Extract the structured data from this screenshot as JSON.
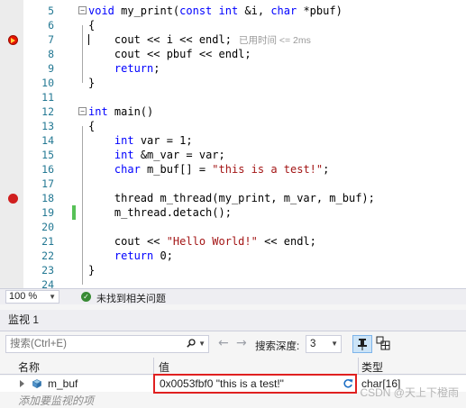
{
  "editor": {
    "lines": [
      {
        "num": "5",
        "glyph": "",
        "fold": "minus",
        "change": false,
        "segs": [
          [
            "k",
            "void"
          ],
          [
            "t",
            " my_print("
          ],
          [
            "k",
            "const"
          ],
          [
            "t",
            " "
          ],
          [
            "k",
            "int"
          ],
          [
            "t",
            " &i, "
          ],
          [
            "k",
            "char"
          ],
          [
            "t",
            " *pbuf)"
          ]
        ]
      },
      {
        "num": "6",
        "glyph": "",
        "fold": "",
        "change": false,
        "segs": [
          [
            "t",
            "{"
          ]
        ]
      },
      {
        "num": "7",
        "glyph": "current",
        "fold": "",
        "change": false,
        "hint": "已用时间 <= 2ms",
        "segs": [
          [
            "t",
            "    cout << i << endl;"
          ]
        ]
      },
      {
        "num": "8",
        "glyph": "",
        "fold": "",
        "change": false,
        "segs": [
          [
            "t",
            "    cout << pbuf << endl;"
          ]
        ]
      },
      {
        "num": "9",
        "glyph": "",
        "fold": "",
        "change": false,
        "segs": [
          [
            "t",
            "    "
          ],
          [
            "k",
            "return"
          ],
          [
            "t",
            ";"
          ]
        ]
      },
      {
        "num": "10",
        "glyph": "",
        "fold": "",
        "change": false,
        "segs": [
          [
            "t",
            "}"
          ]
        ]
      },
      {
        "num": "11",
        "glyph": "",
        "fold": "",
        "change": false,
        "segs": []
      },
      {
        "num": "12",
        "glyph": "",
        "fold": "minus",
        "change": false,
        "segs": [
          [
            "k",
            "int"
          ],
          [
            "t",
            " main()"
          ]
        ]
      },
      {
        "num": "13",
        "glyph": "",
        "fold": "",
        "change": false,
        "segs": [
          [
            "t",
            "{"
          ]
        ]
      },
      {
        "num": "14",
        "glyph": "",
        "fold": "",
        "change": false,
        "segs": [
          [
            "t",
            "    "
          ],
          [
            "k",
            "int"
          ],
          [
            "t",
            " var = 1;"
          ]
        ]
      },
      {
        "num": "15",
        "glyph": "",
        "fold": "",
        "change": false,
        "segs": [
          [
            "t",
            "    "
          ],
          [
            "k",
            "int"
          ],
          [
            "t",
            " &m_var = var;"
          ]
        ]
      },
      {
        "num": "16",
        "glyph": "",
        "fold": "",
        "change": false,
        "segs": [
          [
            "t",
            "    "
          ],
          [
            "k",
            "char"
          ],
          [
            "t",
            " m_buf[] = "
          ],
          [
            "s",
            "\"this is a test!\""
          ],
          [
            "t",
            ";"
          ]
        ]
      },
      {
        "num": "17",
        "glyph": "",
        "fold": "",
        "change": false,
        "segs": []
      },
      {
        "num": "18",
        "glyph": "breakpoint",
        "fold": "",
        "change": false,
        "segs": [
          [
            "t",
            "    thread m_thread(my_print, m_var, m_buf);"
          ]
        ]
      },
      {
        "num": "19",
        "glyph": "",
        "fold": "",
        "change": true,
        "segs": [
          [
            "t",
            "    m_thread.detach();"
          ]
        ]
      },
      {
        "num": "20",
        "glyph": "",
        "fold": "",
        "change": false,
        "segs": []
      },
      {
        "num": "21",
        "glyph": "",
        "fold": "",
        "change": false,
        "segs": [
          [
            "t",
            "    cout << "
          ],
          [
            "s",
            "\"Hello World!\""
          ],
          [
            "t",
            " << endl;"
          ]
        ]
      },
      {
        "num": "22",
        "glyph": "",
        "fold": "",
        "change": false,
        "segs": [
          [
            "t",
            "    "
          ],
          [
            "k",
            "return"
          ],
          [
            "t",
            " 0;"
          ]
        ]
      },
      {
        "num": "23",
        "glyph": "",
        "fold": "",
        "change": false,
        "segs": [
          [
            "t",
            "}"
          ]
        ]
      },
      {
        "num": "24",
        "glyph": "",
        "fold": "",
        "change": false,
        "segs": []
      }
    ]
  },
  "status": {
    "zoom": "100 %",
    "message": "未找到相关问题"
  },
  "watch": {
    "title": "监视 1",
    "search_placeholder": "搜索(Ctrl+E)",
    "depth_label": "搜索深度:",
    "depth_value": "3",
    "columns": {
      "name": "名称",
      "value": "值",
      "type": "类型"
    },
    "rows": [
      {
        "name": "m_buf",
        "value": "0x0053fbf0 \"this is a test!\"",
        "type": "char[16]"
      }
    ],
    "add_placeholder": "添加要监视的项"
  },
  "watermark": "CSDN @天上下橙雨",
  "colors": {
    "keyword": "#0000ff",
    "string": "#a31515",
    "line_number": "#237893",
    "highlight": "#e02020"
  }
}
